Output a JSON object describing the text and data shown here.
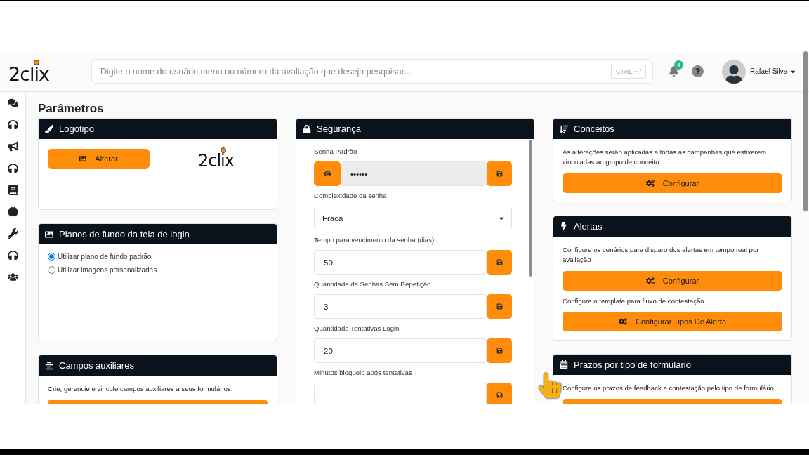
{
  "header": {
    "logo": "2clix",
    "search": {
      "placeholder": "Digite o nome do usuário,menu ou número da avaliação que deseja pesquisar...",
      "shortcut": "CTRL + /"
    },
    "notifications": {
      "count": "4"
    },
    "user": {
      "name": "Rafael Silva"
    }
  },
  "page_title": "Parâmetros",
  "columns": [
    [
      {
        "title": "Logotipo",
        "items": [
          {
            "kind": "button_logo",
            "button": "Alterar",
            "logo": "2clix"
          }
        ]
      },
      {
        "title": "Planos de fundo da tela de login",
        "items": [
          {
            "kind": "radio",
            "label": "Utilizar plano de fundo padrão",
            "selected": true
          },
          {
            "kind": "radio",
            "label": "Utilizar imagens personalizadas",
            "selected": false
          }
        ]
      },
      {
        "title": "Campos auxiliares",
        "items": [
          {
            "kind": "text",
            "text": "Crie, gerencie e vincule campos auxiliares a seus formulários."
          },
          {
            "kind": "button"
          }
        ]
      }
    ],
    [
      {
        "title": "Segurança",
        "items": [
          {
            "kind": "password",
            "label": "Senha Padrão",
            "value": "••••••"
          },
          {
            "kind": "select",
            "label": "Complexidade da senha",
            "value": "Fraca"
          },
          {
            "kind": "input",
            "label": "Tempo para vencimento da senha (dias)",
            "value": "50"
          },
          {
            "kind": "input",
            "label": "Quantidade de Senhas Sem Repetição",
            "value": "3"
          },
          {
            "kind": "input",
            "label": "Quantidade Tentativas Login",
            "value": "20"
          },
          {
            "kind": "input",
            "label": "Minutos bloqueio após tentativas"
          }
        ]
      }
    ],
    [
      {
        "title": "Conceitos",
        "items": [
          {
            "kind": "text",
            "text": "As alterações serão aplicadas a todas as campanhas que estiverem vinculadas ao grupo de conceito."
          },
          {
            "kind": "button",
            "label": "Configurar"
          }
        ]
      },
      {
        "title": "Alertas",
        "items": [
          {
            "kind": "text",
            "text": "Configure os cenários para disparo dos alertas em tempo real por avaliação"
          },
          {
            "kind": "button",
            "label": "Configurar"
          },
          {
            "kind": "text",
            "text": "Configure o template para fluxo de contestação"
          },
          {
            "kind": "button",
            "label": "Configurar Tipos De Alerta"
          }
        ]
      },
      {
        "title": "Prazos por tipo de formulário",
        "items": [
          {
            "kind": "text",
            "text": "Configure os prazos de feedback e contestação pelo tipo de formulário"
          },
          {
            "kind": "button"
          }
        ]
      }
    ]
  ]
}
